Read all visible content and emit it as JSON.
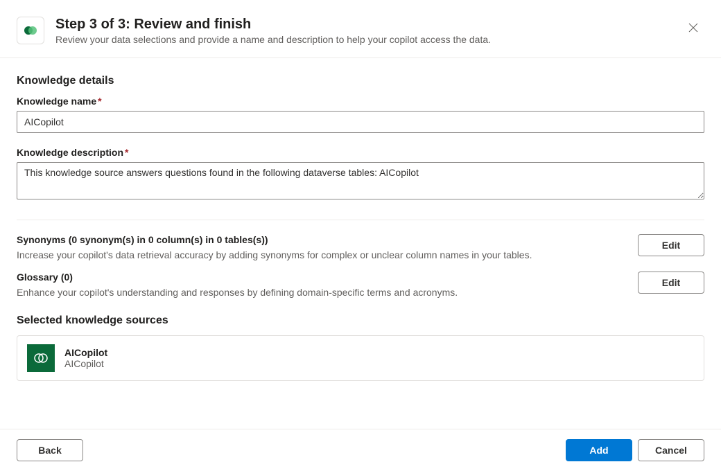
{
  "header": {
    "title": "Step 3 of 3: Review and finish",
    "subtitle": "Review your data selections and provide a name and description to help your copilot access the data."
  },
  "details": {
    "section_title": "Knowledge details",
    "name_label": "Knowledge name",
    "name_value": "AICopilot",
    "desc_label": "Knowledge description",
    "desc_value": "This knowledge source answers questions found in the following dataverse tables: AICopilot"
  },
  "synonyms": {
    "title": "Synonyms (0 synonym(s) in 0 column(s) in 0 tables(s))",
    "desc": "Increase your copilot's data retrieval accuracy by adding synonyms for complex or unclear column names in your tables.",
    "edit_label": "Edit"
  },
  "glossary": {
    "title": "Glossary (0)",
    "desc": "Enhance your copilot's understanding and responses by defining domain-specific terms and acronyms.",
    "edit_label": "Edit"
  },
  "sources": {
    "title": "Selected knowledge sources",
    "items": [
      {
        "name": "AICopilot",
        "sub": "AICopilot"
      }
    ]
  },
  "footer": {
    "back": "Back",
    "add": "Add",
    "cancel": "Cancel"
  }
}
